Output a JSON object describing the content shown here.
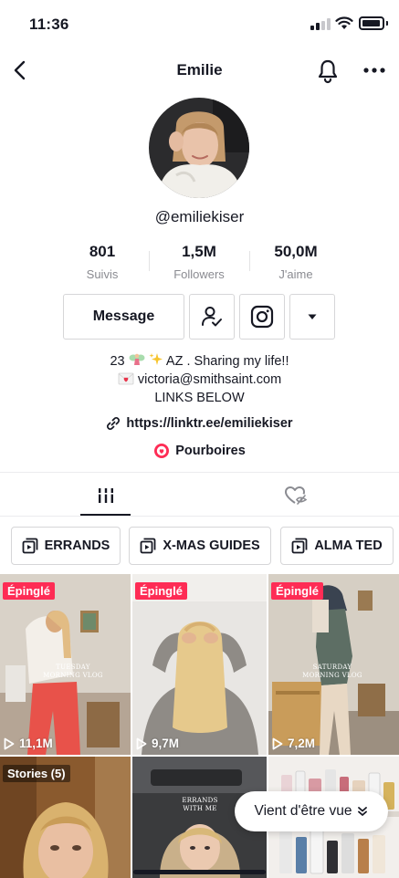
{
  "status_bar": {
    "time": "11:36"
  },
  "nav": {
    "title": "Emilie"
  },
  "profile": {
    "username": "@emiliekiser",
    "stats": [
      {
        "value": "801",
        "label": "Suivis"
      },
      {
        "value": "1,5M",
        "label": "Followers"
      },
      {
        "value": "50,0M",
        "label": "J'aime"
      }
    ],
    "message_label": "Message",
    "bio": {
      "line1_prefix": "23",
      "line1_rest": " AZ . Sharing my life!!",
      "line2": "victoria@smithsaint.com",
      "line3": "LINKS BELOW"
    },
    "link": "https://linktr.ee/emiliekiser",
    "tips_label": "Pourboires"
  },
  "playlists": [
    {
      "label": "ERRANDS"
    },
    {
      "label": "X-MAS GUIDES"
    },
    {
      "label": "ALMA TED"
    }
  ],
  "grid": [
    {
      "badge": "Épinglé",
      "views": "11,1M",
      "overlay_line1": "TUESDAY",
      "overlay_line2": "MORNING VLOG"
    },
    {
      "badge": "Épinglé",
      "views": "9,7M"
    },
    {
      "badge": "Épinglé",
      "views": "7,2M",
      "overlay_line1": "SATURDAY",
      "overlay_line2": "MORNING VLOG"
    },
    {
      "badge": "Stories (5)"
    },
    {
      "overlay_line1": "ERRANDS",
      "overlay_line2": "WITH ME"
    },
    {}
  ],
  "seen_pill": {
    "label": "Vient d'être vue"
  },
  "colors": {
    "accent": "#fe2c55",
    "text": "#161823",
    "muted": "#8a8b91",
    "border": "#d6d6d8"
  }
}
